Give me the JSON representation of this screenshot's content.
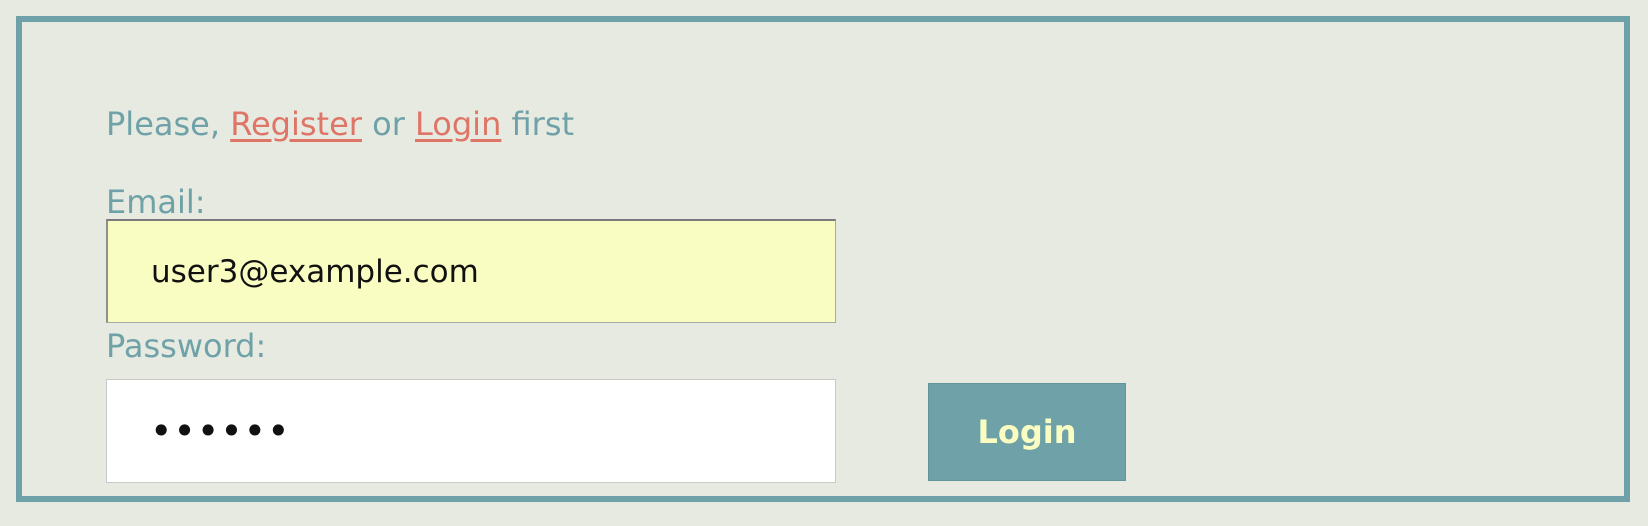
{
  "prompt": {
    "text_before": "Please,",
    "register_link": "Register",
    "text_or": "or",
    "login_link": "Login",
    "text_after": "first"
  },
  "form": {
    "email_label": "Email:",
    "email_value": "user3@example.com",
    "password_label": "Password:",
    "password_value": "••••••",
    "submit_label": "Login"
  },
  "colors": {
    "background": "#e7eae1",
    "border": "#6fa2a8",
    "text_accent": "#6fa2a8",
    "link": "#de7566",
    "email_field_bg": "#fafdc2",
    "button_bg": "#6fa2a8",
    "button_text": "#fafdc2"
  }
}
